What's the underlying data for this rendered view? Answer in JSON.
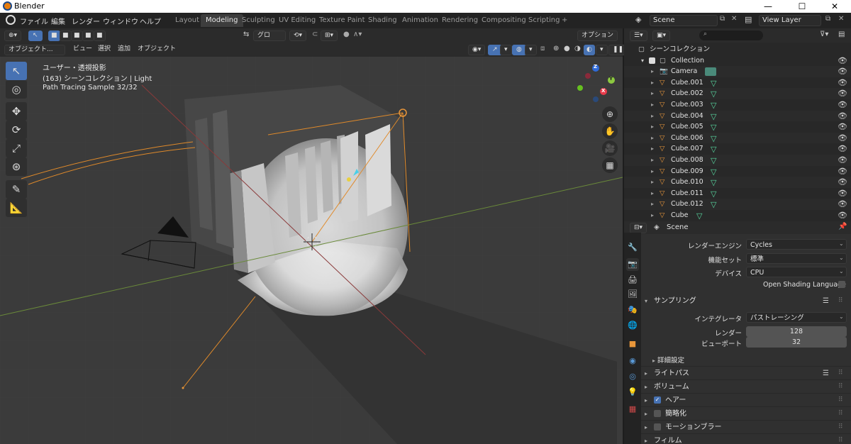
{
  "window": {
    "title": "Blender",
    "minimize": "—",
    "maximize": "☐",
    "close": "✕"
  },
  "menubar": {
    "items": [
      "ファイル",
      "編集",
      "レンダー",
      "ウィンドウ",
      "ヘルプ"
    ]
  },
  "workspaces": {
    "tabs": [
      "Layout",
      "Modeling",
      "Sculpting",
      "UV Editing",
      "Texture Paint",
      "Shading",
      "Animation",
      "Rendering",
      "Compositing",
      "Scripting"
    ],
    "add": "+"
  },
  "scene": {
    "name": "Scene",
    "view_layer": "View Layer"
  },
  "viewport": {
    "header": {
      "transform": "グロー...",
      "options": "オプション"
    },
    "header2": {
      "mode": "オブジェクト...",
      "menus": [
        "ビュー",
        "選択",
        "追加",
        "オブジェクト"
      ]
    },
    "info": {
      "line1": "ユーザー・透視投影",
      "line2": "(163) シーンコレクション | Light",
      "line3": "Path Tracing Sample 32/32"
    },
    "gizmo": {
      "x": "X",
      "y": "Y",
      "z": "Z"
    }
  },
  "outliner": {
    "search_placeholder": "",
    "root": "シーンコレクション",
    "collection": "Collection",
    "items": [
      {
        "name": "Camera",
        "type": "camera"
      },
      {
        "name": "Cube.001",
        "type": "mesh"
      },
      {
        "name": "Cube.002",
        "type": "mesh"
      },
      {
        "name": "Cube.003",
        "type": "mesh"
      },
      {
        "name": "Cube.004",
        "type": "mesh"
      },
      {
        "name": "Cube.005",
        "type": "mesh"
      },
      {
        "name": "Cube.006",
        "type": "mesh"
      },
      {
        "name": "Cube.007",
        "type": "mesh"
      },
      {
        "name": "Cube.008",
        "type": "mesh"
      },
      {
        "name": "Cube.009",
        "type": "mesh"
      },
      {
        "name": "Cube.010",
        "type": "mesh"
      },
      {
        "name": "Cube.011",
        "type": "mesh"
      },
      {
        "name": "Cube.012",
        "type": "mesh"
      },
      {
        "name": "Cube",
        "type": "mesh"
      }
    ]
  },
  "properties": {
    "context": "Scene",
    "render_engine": {
      "label": "レンダーエンジン",
      "value": "Cycles"
    },
    "feature_set": {
      "label": "機能セット",
      "value": "標準"
    },
    "device": {
      "label": "デバイス",
      "value": "CPU"
    },
    "osl": {
      "label": "Open Shading Language",
      "checked": false
    },
    "sampling": {
      "title": "サンプリング",
      "integrator": {
        "label": "インテグレータ",
        "value": "パストレーシング"
      },
      "render": {
        "label": "レンダー",
        "value": "128"
      },
      "viewport": {
        "label": "ビューポート",
        "value": "32"
      },
      "advanced": "詳細設定"
    },
    "panels": [
      {
        "title": "ライトパス",
        "checkbox": null
      },
      {
        "title": "ボリューム",
        "checkbox": null
      },
      {
        "title": "ヘアー",
        "checkbox": true
      },
      {
        "title": "簡略化",
        "checkbox": false
      },
      {
        "title": "モーションブラー",
        "checkbox": false
      },
      {
        "title": "フィルム",
        "checkbox": null
      }
    ]
  }
}
